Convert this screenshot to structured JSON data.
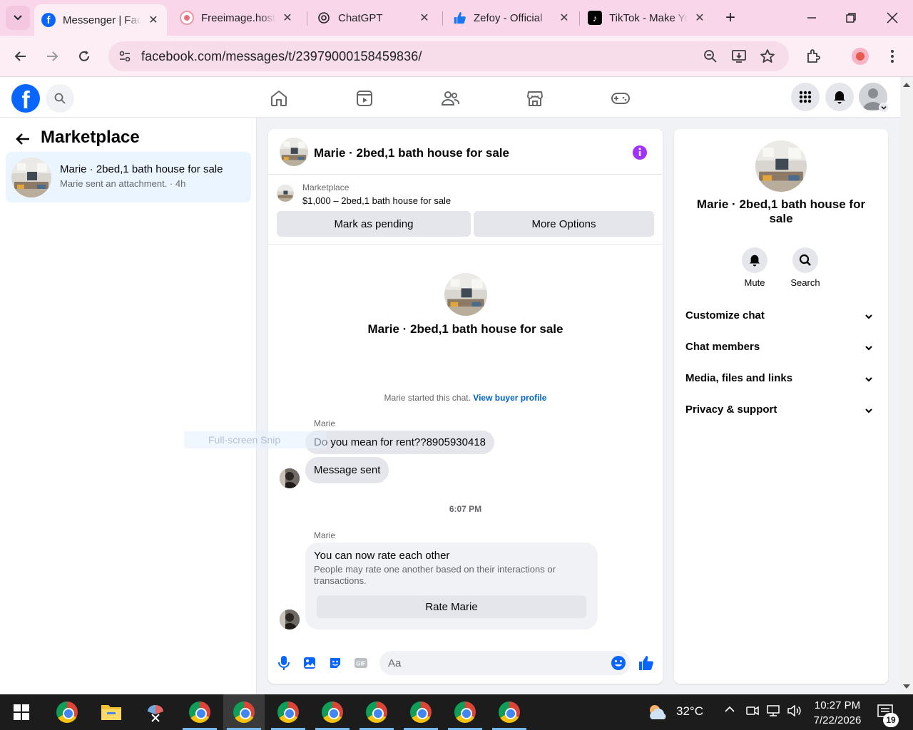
{
  "browser": {
    "tabs": [
      {
        "title": "Messenger | Facebook",
        "active": true
      },
      {
        "title": "Freeimage.host",
        "active": false
      },
      {
        "title": "ChatGPT",
        "active": false
      },
      {
        "title": "Zefoy - Official",
        "active": false
      },
      {
        "title": "TikTok - Make Your Day",
        "active": false
      }
    ],
    "url": "facebook.com/messages/t/23979000158459836/"
  },
  "left": {
    "title": "Marketplace",
    "conversation": {
      "name": "Marie · 2bed,1 bath house for sale",
      "preview": "Marie sent an attachment. · 4h"
    }
  },
  "chat": {
    "header_name": "Marie · 2bed,1 bath house for sale",
    "listing_kind": "Marketplace",
    "listing_desc": "$1,000 – 2bed,1 bath house for sale",
    "mark_pending": "Mark as pending",
    "more_options": "More Options",
    "intro_name": "Marie · 2bed,1 bath house for sale",
    "started_text": "Marie started this chat.",
    "view_buyer_profile": "View buyer profile",
    "sender1": "Marie",
    "msg1": "Do you mean for rent??8905930418",
    "msg2": "Message sent",
    "timestamp": "6:07 PM",
    "sender2": "Marie",
    "rate_title": "You can now rate each other",
    "rate_desc": "People may rate one another based on their interactions or transactions.",
    "rate_button": "Rate Marie",
    "composer_placeholder": "Aa"
  },
  "snip_overlay": "Full-screen Snip",
  "right": {
    "name": "Marie · 2bed,1 bath house for sale",
    "mute": "Mute",
    "search": "Search",
    "sections": [
      "Customize chat",
      "Chat members",
      "Media, files and links",
      "Privacy & support"
    ]
  },
  "taskbar": {
    "temperature": "32°C",
    "time": "10:27 PM",
    "date": "7/22/2026",
    "notifications": "19"
  },
  "colors": {
    "fb_blue": "#0866ff",
    "tab_pink": "#f9d6ea",
    "info_purple": "#a033ff",
    "link_blue": "#0064d1"
  }
}
